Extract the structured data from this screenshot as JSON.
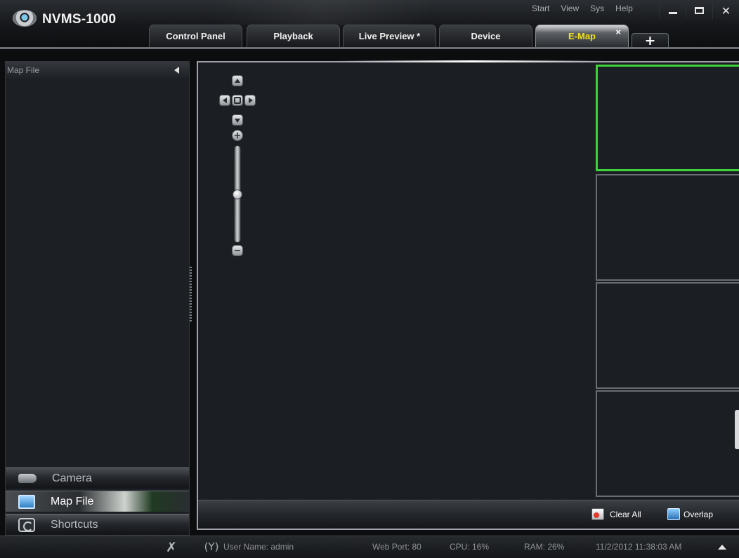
{
  "app": {
    "title": "NVMS-1000"
  },
  "menu": [
    "Start",
    "View",
    "Sys",
    "Help"
  ],
  "window_controls": [
    "minimize-icon",
    "maximize-icon",
    "close-icon"
  ],
  "tabs": [
    {
      "label": "Control Panel",
      "active": false
    },
    {
      "label": "Playback",
      "active": false
    },
    {
      "label": "Live Preview *",
      "active": false
    },
    {
      "label": "Device",
      "active": false
    },
    {
      "label": "E-Map",
      "active": true,
      "closable": true
    }
  ],
  "tab_close_glyph": "×",
  "tab_add_glyph": "+",
  "left_panel": {
    "header": "Map File",
    "accordion": [
      {
        "label": "Camera",
        "icon": "camera-icon",
        "active": false
      },
      {
        "label": "Map File",
        "icon": "map-file-icon",
        "active": true
      },
      {
        "label": "Shortcuts",
        "icon": "shortcuts-icon",
        "active": false
      }
    ]
  },
  "map_controls": {
    "ptz": [
      "up-arrow-icon",
      "left-arrow-icon",
      "center-icon",
      "right-arrow-icon",
      "down-arrow-icon"
    ],
    "zoom_in_glyph": "+",
    "zoom_out_glyph": "−",
    "zoom_level": 0.5
  },
  "video_tiles": {
    "count": 4,
    "active_index": 0
  },
  "map_footer": {
    "clear_all": "Clear All",
    "overlap": "Overlap"
  },
  "status": {
    "user": "User Name: admin",
    "web_port": "Web Port: 80",
    "cpu": "CPU: 16%",
    "ram": "RAM: 26%",
    "datetime": "11/2/2012 11:38:03 AM"
  },
  "colors": {
    "active_tab_text": "#f2e21a",
    "active_tile_border": "#3fd13a",
    "background": "#1b1f23"
  }
}
